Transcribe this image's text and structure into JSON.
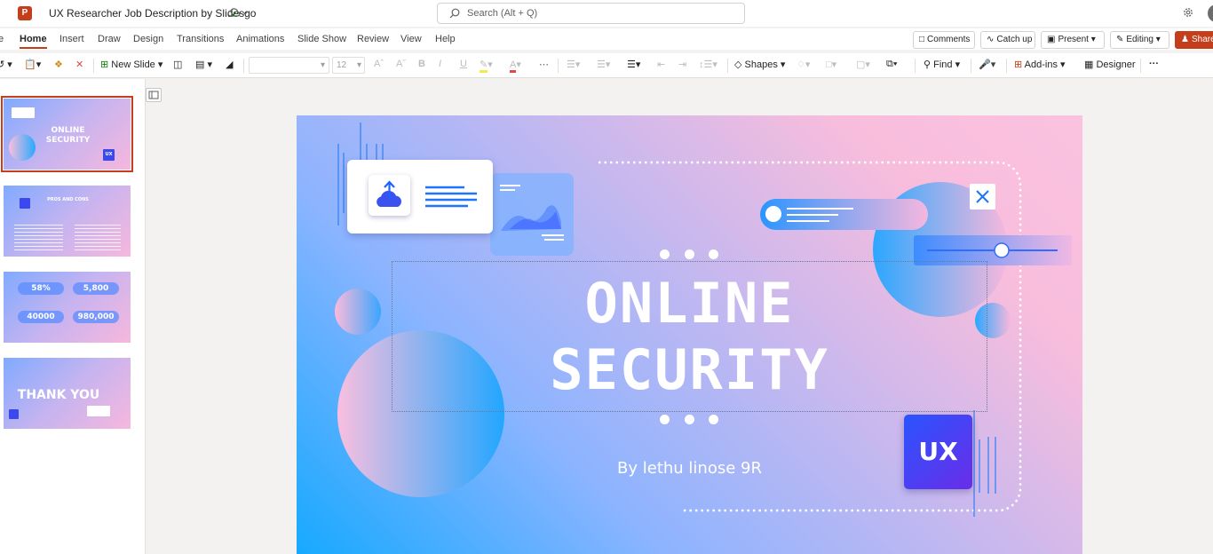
{
  "app": {
    "logo_letter": "P",
    "doc_title": "UX Researcher Job Description by Slidesgo",
    "search_placeholder": "Search (Alt + Q)"
  },
  "menu_tabs": [
    "e",
    "Home",
    "Insert",
    "Draw",
    "Design",
    "Transitions",
    "Animations",
    "Slide Show",
    "Review",
    "View",
    "Help"
  ],
  "tab_actions": {
    "comments": "Comments",
    "catch_up": "Catch up",
    "present": "Present",
    "editing": "Editing",
    "share": "Share"
  },
  "ribbon": {
    "new_slide": "New Slide",
    "font_size": "12",
    "shapes": "Shapes",
    "find": "Find",
    "add_ins": "Add-ins",
    "designer": "Designer"
  },
  "thumbnails": [
    {
      "title_line1": "ONLINE",
      "title_line2": "SECURITY",
      "ux": "UX"
    },
    {
      "heading": "PROS AND CONS"
    },
    {
      "stat1": "58%",
      "stat2": "5,800",
      "stat3": "40000",
      "stat4": "980,000"
    },
    {
      "title": "THANK YOU"
    }
  ],
  "slide": {
    "title_line1": "ONLINE",
    "title_line2": "SECURITY",
    "subtitle": "By lethu linose 9R",
    "badge": "UX"
  },
  "colors": {
    "brand": "#c43e1c",
    "accent_blue": "#1f74ff",
    "slide_gradient_start": "#16a9ff",
    "slide_gradient_end": "#fbc2e0"
  }
}
